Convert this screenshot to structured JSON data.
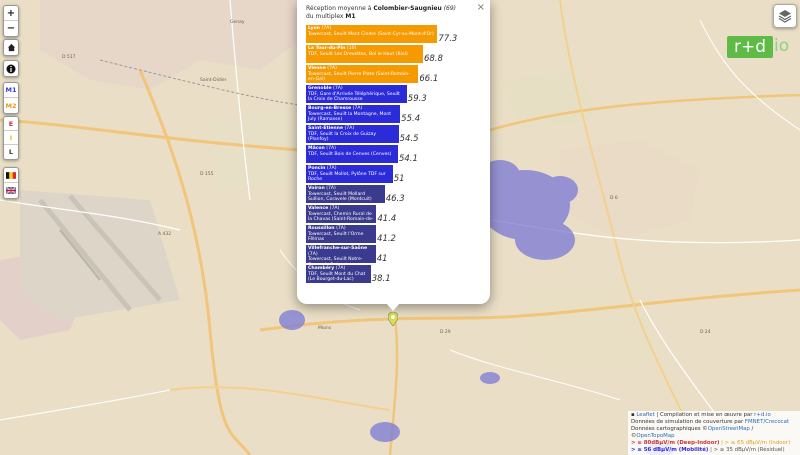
{
  "map": {
    "places": [
      "Genay",
      "Saint-Didier",
      "Mions",
      "Colombier-Saugnieu"
    ],
    "road_labels": [
      "D 517",
      "A 432",
      "D 29",
      "D 155",
      "D 6",
      "D 24"
    ],
    "colors": {
      "base": "#eadfc6",
      "urban": "#e3d0c9",
      "road_main": "#f1c57a",
      "road_minor": "#ffffff",
      "coverage": "#7a79d6"
    }
  },
  "controls": {
    "zoom_in": "+",
    "zoom_out": "−",
    "buttons": [
      "M1",
      "M2",
      "E",
      "I",
      "L"
    ],
    "m1_color": "#3b3bd4",
    "m2_color": "#e79b1b"
  },
  "logo": {
    "text": "r+d",
    "tail": "io"
  },
  "popup": {
    "title_prefix": "Réception moyenne à ",
    "title_place": "Colombier-Saugnieu",
    "title_dept": "(69)",
    "title_line2": "du multiplex ",
    "title_mux": "M1",
    "close": "×"
  },
  "chart_data": {
    "type": "bar",
    "orientation": "horizontal",
    "title": "Réception moyenne à Colombier-Saugnieu (69) du multiplex M1",
    "categories": [
      "Lyon",
      "La Tour-du-Pin",
      "Vienne",
      "Grenoble",
      "Bourg-en-Bresse",
      "Saint-Etienne",
      "Mâcon",
      "Poncin",
      "Voiron",
      "Valence",
      "Roussillon",
      "Villefranche-sur-Saône",
      "Chambéry"
    ],
    "values": [
      77.3,
      68.8,
      66.1,
      59.3,
      55.4,
      54.5,
      54.1,
      51,
      46.3,
      41.4,
      41.2,
      41,
      38.1
    ],
    "xlim": [
      0,
      100
    ],
    "series_detail": [
      {
        "station": "Lyon",
        "tag": "(7A)",
        "desc": "Towercast, Seuilt Mont Cindre (Saint-Cyr-au-Mont-d'Or)",
        "color": "#f59a00"
      },
      {
        "station": "La Tour-du-Pin",
        "tag": "(10)",
        "desc": "TDF, Seuilt Les Drevettes, Bol le Haut (Biol)",
        "color": "#f59a00"
      },
      {
        "station": "Vienne",
        "tag": "(7A)",
        "desc": "Towercast, Seuilt Pierre Plate (Saint-Romain-en-Gal)",
        "color": "#f59a00"
      },
      {
        "station": "Grenoble",
        "tag": "(7A)",
        "desc": "TDF, Gare d'Arrivée Téléphérique, Seuilt la Croix de Chamrousse",
        "color": "#2b2bd8"
      },
      {
        "station": "Bourg-en-Bresse",
        "tag": "(7A)",
        "desc": "Towercast, Seuilt la Montagne, Mont July (Ramasse)",
        "color": "#2b2bd8"
      },
      {
        "station": "Saint-Etienne",
        "tag": "(7A)",
        "desc": "TDF, Seuilt la Croix de Guizay (Planfoy)",
        "color": "#2b2bd8"
      },
      {
        "station": "Mâcon",
        "tag": "(7A)",
        "desc": "TDF, Seuilt Bois de Cenves (Cenves)",
        "color": "#2b2bd8"
      },
      {
        "station": "Poncin",
        "tag": "(7A)",
        "desc": "TDF, Seuilt Mollot, Pylône TDF sur Roche",
        "color": "#2b2bd8"
      },
      {
        "station": "Voiron",
        "tag": "(7A)",
        "desc": "Towercast, Seuilt Mollard Sullion, Coravele (Montcuit)",
        "color": "#3a3a8e"
      },
      {
        "station": "Valence",
        "tag": "(7A)",
        "desc": "Towercast, Chemin Rural de la Chavas (Saint-Romain-de-Lerps)",
        "color": "#3a3a8e"
      },
      {
        "station": "Roussillon",
        "tag": "(7A)",
        "desc": "Towercast, Seuilt l'Orme Fêlmas",
        "color": "#3a3a8e"
      },
      {
        "station": "Villefranche-sur-Saône",
        "tag": "(7A)",
        "desc": "Towercast, Seuilt Notre-Dame de Buisante (Pommiers)",
        "color": "#3a3a8e"
      },
      {
        "station": "Chambéry",
        "tag": "(7A)",
        "desc": "TDF, Seuilt Mont du Chat (Le Bourget-du-Lac)",
        "color": "#3a3a8e"
      }
    ]
  },
  "attribution": {
    "leaflet": "Leaflet",
    "line1_rest": " | Compilation et mise en œuvre par ",
    "rd": "r+d.io",
    "line2": "Données de simulation de couverture par ",
    "fmnet": "FMNET/Crecocat",
    "line3": "Données cartographiques ©",
    "osm": "OpenStreetMap",
    "line3_mid": " / ©",
    "otm": "OpenTopoMap",
    "legend1": "> ≥ 80dBµV/m (Deep-Indoor)",
    "legend2": " | > ≥ 65 dBµV/m (Indoor)",
    "legend3": "> ≥ 56 dBµV/m (Mobilité)",
    "legend4": " | > ≥ 35 dBµV/m (Résiduel)"
  }
}
